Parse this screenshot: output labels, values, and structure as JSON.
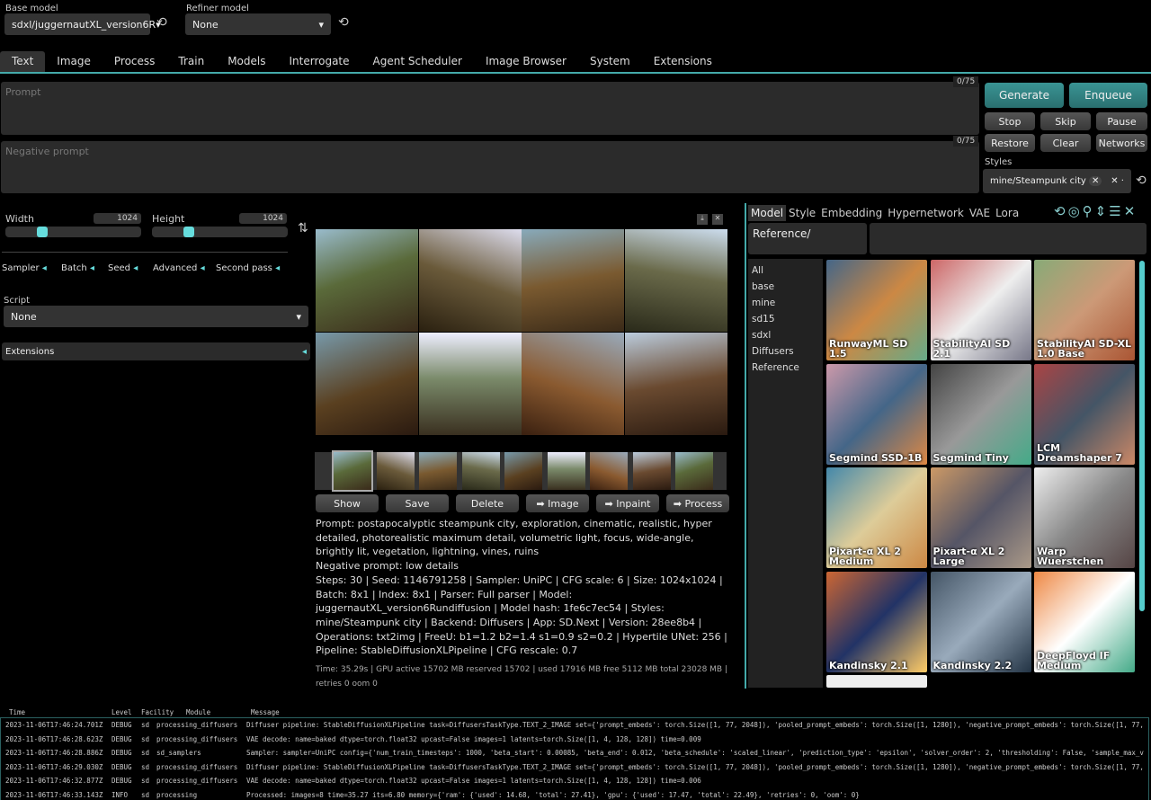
{
  "top": {
    "base_label": "Base model",
    "base_value": "sdxl/juggernautXL_version6R",
    "refiner_label": "Refiner model",
    "refiner_value": "None"
  },
  "tabs": [
    "Text",
    "Image",
    "Process",
    "Train",
    "Models",
    "Interrogate",
    "Agent Scheduler",
    "Image Browser",
    "System",
    "Extensions"
  ],
  "prompt": {
    "placeholder": "Prompt",
    "counter": "0/75",
    "neg_placeholder": "Negative prompt",
    "neg_counter": "0/75"
  },
  "actions": {
    "generate": "Generate",
    "enqueue": "Enqueue",
    "stop": "Stop",
    "skip": "Skip",
    "pause": "Pause",
    "restore": "Restore",
    "clear": "Clear",
    "networks": "Networks",
    "styles_label": "Styles",
    "style_chip": "mine/Steampunk city"
  },
  "params": {
    "width_label": "Width",
    "width": "1024",
    "height_label": "Height",
    "height": "1024",
    "width_fraction": 0.25,
    "height_fraction": 0.25,
    "accordions": [
      "Sampler",
      "Batch",
      "Seed",
      "Advanced",
      "Second pass"
    ],
    "script_label": "Script",
    "script_value": "None",
    "extensions": "Extensions"
  },
  "gallery": {
    "buttons": [
      "Show",
      "Save",
      "Delete",
      "➡ Image",
      "➡ Inpaint",
      "➡ Process"
    ],
    "prompt": "Prompt: postapocalyptic steampunk city, exploration, cinematic, realistic, hyper detailed, photorealistic maximum detail, volumetric light, focus, wide-angle, brightly lit, vegetation, lightning, vines, ruins",
    "negative": "Negative prompt: low details",
    "params": "Steps: 30 | Seed: 1146791258 | Sampler: UniPC | CFG scale: 6 | Size: 1024x1024 | Batch: 8x1 | Index: 8x1 | Parser: Full parser | Model: juggernautXL_version6Rundiffusion | Model hash: 1fe6c7ec54 | Styles: mine/Steampunk city | Backend: Diffusers | App: SD.Next | Version: 28ee8b4 | Operations: txt2img | FreeU: b1=1.2 b2=1.4 s1=0.9 s2=0.2 | Hypertile UNet: 256 | Pipeline: StableDiffusionXLPipeline | CFG rescale: 0.7",
    "time": "Time: 35.29s | GPU active 15702 MB reserved 15702 | used 17916 MB free 5112 MB total 23028 MB | retries 0 oom 0"
  },
  "networks": {
    "tabs": [
      "Model",
      "Style",
      "Embedding",
      "Hypernetwork",
      "VAE",
      "Lora"
    ],
    "filter": "Reference/",
    "folders": [
      "All",
      "base",
      "mine",
      "sd15",
      "sdxl",
      "Diffusers",
      "Reference"
    ],
    "cards": [
      "RunwayML SD 1.5",
      "StabilityAI SD 2.1",
      "StabilityAI SD-XL 1.0 Base",
      "Segmind SSD-1B",
      "Segmind Tiny",
      "LCM Dreamshaper 7",
      "Pixart-α XL 2 Medium",
      "Pixart-α XL 2 Large",
      "Warp Wuerstchen",
      "Kandinsky 2.1",
      "Kandinsky 2.2",
      "DeepFloyd IF Medium"
    ]
  },
  "log": {
    "headers": [
      "Time",
      "Level",
      "Facility",
      "Module",
      "Message"
    ],
    "rows": [
      [
        "2023-11-06T17:46:24.701Z",
        "DEBUG",
        "sd",
        "processing_diffusers",
        "Diffuser pipeline: StableDiffusionXLPipeline task=DiffusersTaskType.TEXT_2_IMAGE set={'prompt_embeds': torch.Size([1, 77, 2048]), 'pooled_prompt_embeds': torch.Size([1, 1280]), 'negative_prompt_embeds': torch.Size([1, 77,"
      ],
      [
        "2023-11-06T17:46:28.623Z",
        "DEBUG",
        "sd",
        "processing_diffusers",
        "VAE decode: name=baked dtype=torch.float32 upcast=False images=1 latents=torch.Size([1, 4, 128, 128]) time=0.009"
      ],
      [
        "2023-11-06T17:46:28.886Z",
        "DEBUG",
        "sd",
        "sd_samplers",
        "Sampler: sampler=UniPC config={'num_train_timesteps': 1000, 'beta_start': 0.00085, 'beta_end': 0.012, 'beta_schedule': 'scaled_linear', 'prediction_type': 'epsilon', 'solver_order': 2, 'thresholding': False, 'sample_max_v"
      ],
      [
        "2023-11-06T17:46:29.030Z",
        "DEBUG",
        "sd",
        "processing_diffusers",
        "Diffuser pipeline: StableDiffusionXLPipeline task=DiffusersTaskType.TEXT_2_IMAGE set={'prompt_embeds': torch.Size([1, 77, 2048]), 'pooled_prompt_embeds': torch.Size([1, 1280]), 'negative_prompt_embeds': torch.Size([1, 77,"
      ],
      [
        "2023-11-06T17:46:32.877Z",
        "DEBUG",
        "sd",
        "processing_diffusers",
        "VAE decode: name=baked dtype=torch.float32 upcast=False images=1 latents=torch.Size([1, 4, 128, 128]) time=0.006"
      ],
      [
        "2023-11-06T17:46:33.143Z",
        "INFO",
        "sd",
        "processing",
        "Processed: images=8 time=35.27 its=6.80 memory={'ram': {'used': 14.68, 'total': 27.41}, 'gpu': {'used': 17.47, 'total': 22.49}, 'retries': 0, 'oom': 0}"
      ]
    ]
  },
  "colors": {
    "accent": "#3a9494",
    "slider": "#66dddd"
  }
}
